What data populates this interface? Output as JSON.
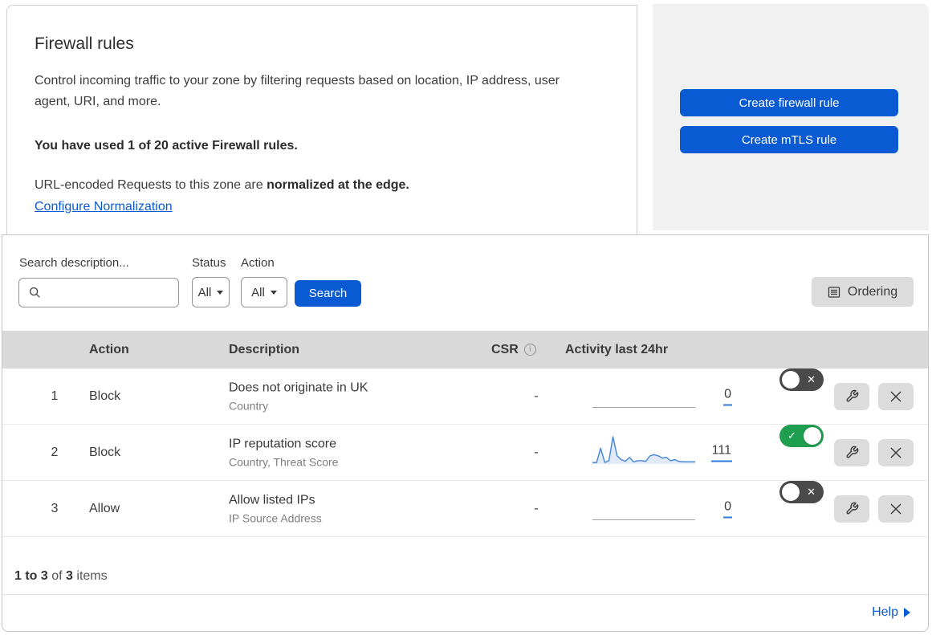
{
  "header": {
    "title": "Firewall rules",
    "description": "Control incoming traffic to your zone by filtering requests based on location, IP address, user agent, URI, and more.",
    "usage": "You have used 1 of 20 active Firewall rules.",
    "normalization_prefix": "URL-encoded Requests to this zone are ",
    "normalization_bold": "normalized at the edge.",
    "normalization_link": "Configure Normalization",
    "buttons": {
      "create_firewall": "Create firewall rule",
      "create_mtls": "Create mTLS rule"
    }
  },
  "filters": {
    "search_label": "Search description...",
    "search_value": "",
    "status_label": "Status",
    "status_value": "All",
    "action_label": "Action",
    "action_value": "All",
    "search_button": "Search",
    "ordering_button": "Ordering"
  },
  "table": {
    "columns": {
      "action": "Action",
      "description": "Description",
      "csr": "CSR",
      "activity": "Activity last 24hr"
    },
    "rows": [
      {
        "priority": "1",
        "action": "Block",
        "description": "Does not originate in UK",
        "fields": "Country",
        "csr": "-",
        "activity_count": "0",
        "enabled": false,
        "sparkline": null
      },
      {
        "priority": "2",
        "action": "Block",
        "description": "IP reputation score",
        "fields": "Country, Threat Score",
        "csr": "-",
        "activity_count": "111",
        "enabled": true,
        "sparkline": {
          "type": "area",
          "x_range": "last 24hr",
          "values": [
            0.05,
            0.05,
            0.58,
            0.06,
            0.12,
            1.0,
            0.3,
            0.16,
            0.1,
            0.24,
            0.08,
            0.12,
            0.12,
            0.1,
            0.3,
            0.34,
            0.3,
            0.22,
            0.24,
            0.12,
            0.16,
            0.1,
            0.08,
            0.08,
            0.08,
            0.08
          ]
        }
      },
      {
        "priority": "3",
        "action": "Allow",
        "description": "Allow listed IPs",
        "fields": "IP Source Address",
        "csr": "-",
        "activity_count": "0",
        "enabled": false,
        "sparkline": null
      }
    ]
  },
  "footer": {
    "range": "1 to 3",
    "of_text": " of ",
    "total": "3",
    "items_text": " items",
    "help": "Help"
  },
  "colors": {
    "accent_blue": "#0a5bd3",
    "toggle_on_green": "#1f9e50",
    "toggle_off_gray": "#4a4a4a",
    "table_header_gray": "#d9d9d9",
    "panel_gray": "#f1f1f1",
    "sparkline_stroke": "#4e8bd6",
    "sparkline_fill": "rgba(120,162,222,0.22)"
  }
}
